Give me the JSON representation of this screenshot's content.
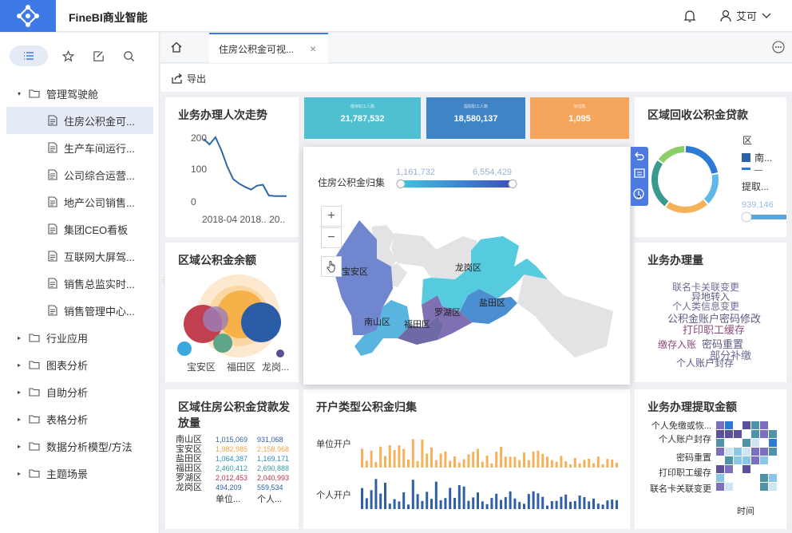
{
  "app": {
    "title": "FineBI商业智能",
    "user": "艾可"
  },
  "sidebar": {
    "items": [
      {
        "label": "管理驾驶舱",
        "type": "folder",
        "expanded": true
      },
      {
        "label": "住房公积金可...",
        "type": "doc",
        "selected": true
      },
      {
        "label": "生产车间运行...",
        "type": "doc"
      },
      {
        "label": "公司综合运营...",
        "type": "doc"
      },
      {
        "label": "地产公司销售...",
        "type": "doc"
      },
      {
        "label": "集团CEO看板",
        "type": "doc"
      },
      {
        "label": "互联网大屏驾...",
        "type": "doc"
      },
      {
        "label": "销售总监实时...",
        "type": "doc"
      },
      {
        "label": "销售管理中心...",
        "type": "doc"
      },
      {
        "label": "行业应用",
        "type": "folder"
      },
      {
        "label": "图表分析",
        "type": "folder"
      },
      {
        "label": "自助分析",
        "type": "folder"
      },
      {
        "label": "表格分析",
        "type": "folder"
      },
      {
        "label": "数据分析模型/方法",
        "type": "folder"
      },
      {
        "label": "主题场景",
        "type": "folder"
      }
    ]
  },
  "tabs": {
    "doc_tab": "住房公积金可视..."
  },
  "toolbar": {
    "export": "导出"
  },
  "kpis": [
    {
      "label": "缴存职工人数",
      "value": "21,787,532",
      "color": "#4fbfd2"
    },
    {
      "label": "提取职工人数",
      "value": "18,580,137",
      "color": "#3f84c4"
    },
    {
      "label": "单位数",
      "value": "1,095",
      "color": "#f6a55d"
    }
  ],
  "trend": {
    "title": "业务办理人次走势",
    "xlabel": "2018-04 2018.. 20.."
  },
  "loan_recovery": {
    "title": "区域回收公积金贷款",
    "legend_title": "区",
    "legend_item": "南...",
    "legend_item2": "—",
    "sub_label": "提取...",
    "sub_value": "939,146"
  },
  "balance": {
    "title": "区域公积金余额",
    "labels": [
      "宝安区",
      "福田区",
      "龙岗..."
    ]
  },
  "map": {
    "filter_label": "住房公积金归集",
    "range_min": "1,161,732",
    "range_max": "6,554,429",
    "zoom_in": "+",
    "zoom_out": "−",
    "districts": [
      "宝安区",
      "龙岗区",
      "盐田区",
      "罗湖区",
      "南山区",
      "福田区"
    ]
  },
  "business": {
    "title": "业务办理量",
    "words": [
      "联名卡关联变更",
      "异地转入",
      "个人类信息变更",
      "公积金账户密码修改",
      "打印职工缓存",
      "缴存入账",
      "密码重置",
      "部分补缴",
      "个人账户封存"
    ]
  },
  "loan_issued": {
    "title": "区域住房公积金贷款发放量",
    "rows": [
      [
        "南山区",
        "1,015,069",
        "931,068"
      ],
      [
        "宝安区",
        "1,982,985",
        "2,158,968"
      ],
      [
        "盐田区",
        "1,064,387",
        "1,169,171"
      ],
      [
        "福田区",
        "2,460,412",
        "2,690,888"
      ],
      [
        "罗湖区",
        "2,012,453",
        "2,040,993"
      ],
      [
        "龙岗区",
        "494,209",
        "559,534"
      ]
    ],
    "footer": [
      "单位...",
      "个人..."
    ]
  },
  "collection": {
    "title": "开户类型公积金归集",
    "series": [
      "单位开户",
      "个人开户"
    ]
  },
  "withdraw": {
    "title": "业务办理提取金额",
    "rows": [
      "个人免缴或恢...",
      "个人账户封存",
      "密码重置",
      "打印职工缓存",
      "联名卡关联变更"
    ],
    "xlabel": "时间"
  },
  "chart_data": [
    {
      "type": "line",
      "title": "业务办理人次走势",
      "ylim": [
        0,
        200
      ],
      "yticks": [
        200,
        100,
        0
      ],
      "values": [
        195,
        178,
        200,
        160,
        110,
        72,
        58,
        48,
        40,
        52,
        55,
        22,
        20,
        20,
        20
      ],
      "xlabel": "2018-04 2018.. 20.."
    },
    {
      "type": "pie",
      "title": "区域回收公积金贷款",
      "values": [
        22,
        16,
        22,
        25,
        15
      ],
      "colors": [
        "#2b7bd6",
        "#60b8e6",
        "#f5b25a",
        "#3a9a8e",
        "#8ccf6a"
      ]
    }
  ]
}
